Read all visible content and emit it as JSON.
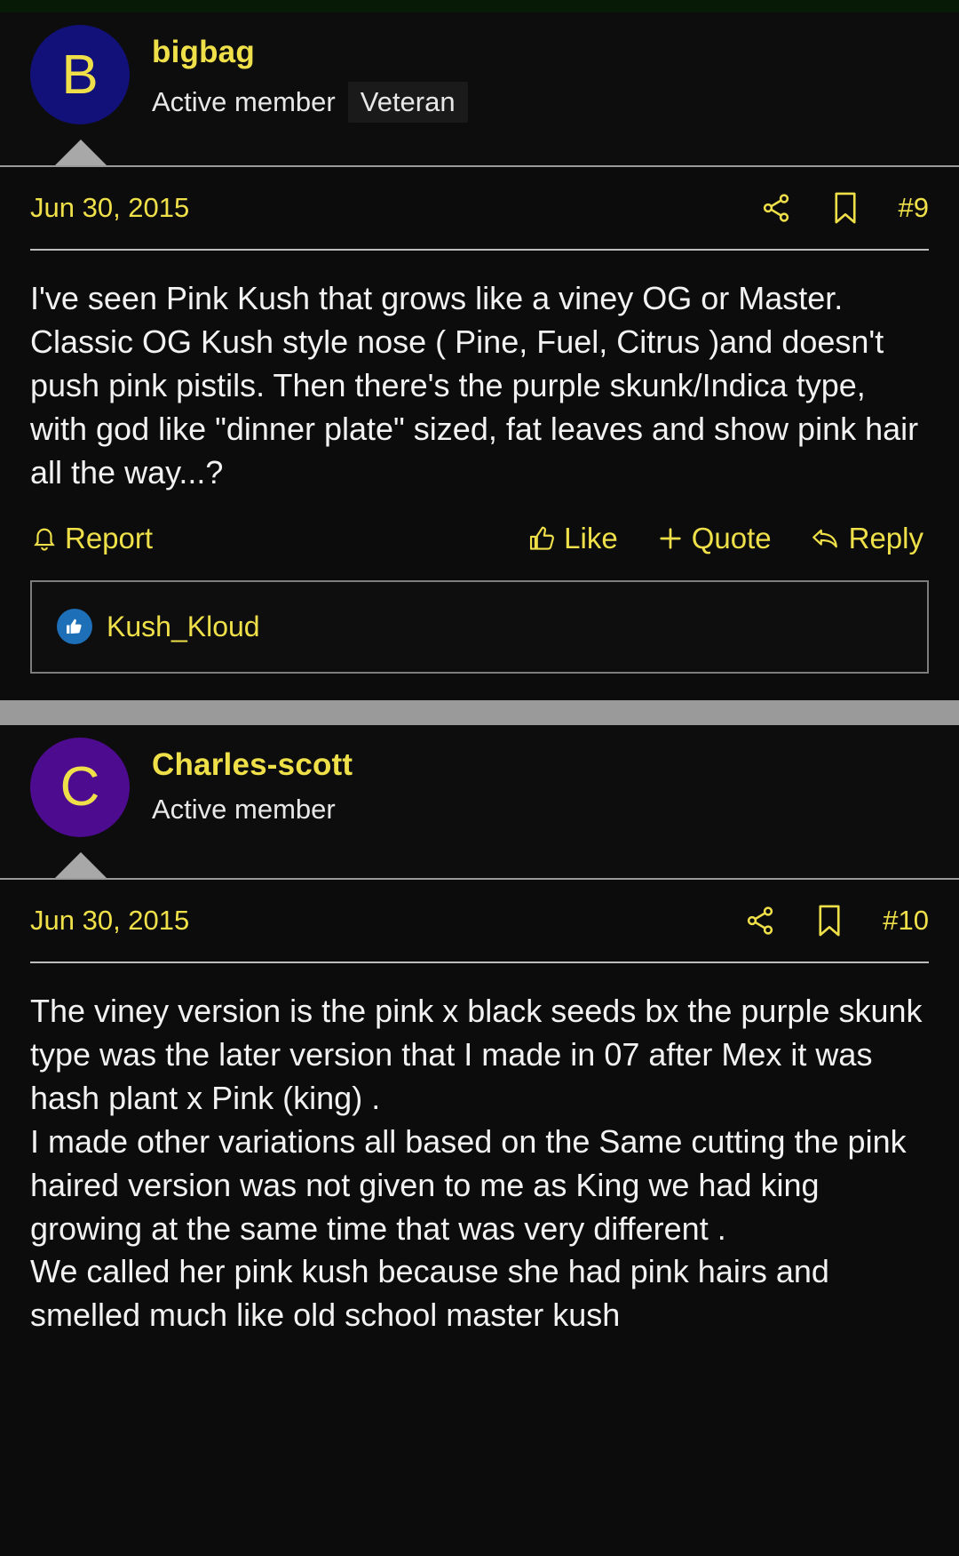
{
  "theme": {
    "background": "#0c0c0c",
    "accent_yellow": "#efe04a",
    "text_white": "#f2f2f2",
    "separator_gray": "#9a9a9a",
    "topstrip_green": "#061a06",
    "like_badge_blue": "#1d6fb8"
  },
  "posts": [
    {
      "avatar_letter": "B",
      "avatar_color": "#12117a",
      "username": "bigbag",
      "user_title": "Active member",
      "badge": "Veteran",
      "date": "Jun 30, 2015",
      "post_number": "#9",
      "body": "I've seen Pink Kush that grows like a viney OG or Master. Classic OG Kush style nose ( Pine, Fuel, Citrus )and doesn't push pink pistils. Then there's the purple skunk/Indica type, with god like \"dinner plate\" sized, fat leaves and show pink hair all the way...?",
      "actions": {
        "report": "Report",
        "like": "Like",
        "quote": "Quote",
        "reply": "Reply"
      },
      "likes": [
        {
          "name": "Kush_Kloud"
        }
      ]
    },
    {
      "avatar_letter": "C",
      "avatar_color": "#4d0b8f",
      "username": "Charles-scott",
      "user_title": "Active member",
      "badge": "",
      "date": "Jun 30, 2015",
      "post_number": "#10",
      "body": "The viney version is the pink x black seeds bx the purple skunk type was the later version that I made in 07 after Mex it was hash plant x Pink (king) .\nI made other variations all based on the Same cutting the pink haired version was not given to me as King we had king growing at the same time that was very different .\nWe called her pink kush because she had pink hairs and smelled much like old school master kush"
    }
  ],
  "icons": {
    "share": "share-icon",
    "bookmark": "bookmark-icon",
    "bell": "bell-icon",
    "thumbs_up": "thumbs-up-icon",
    "plus": "plus-icon",
    "reply_arrow": "reply-arrow-icon"
  }
}
